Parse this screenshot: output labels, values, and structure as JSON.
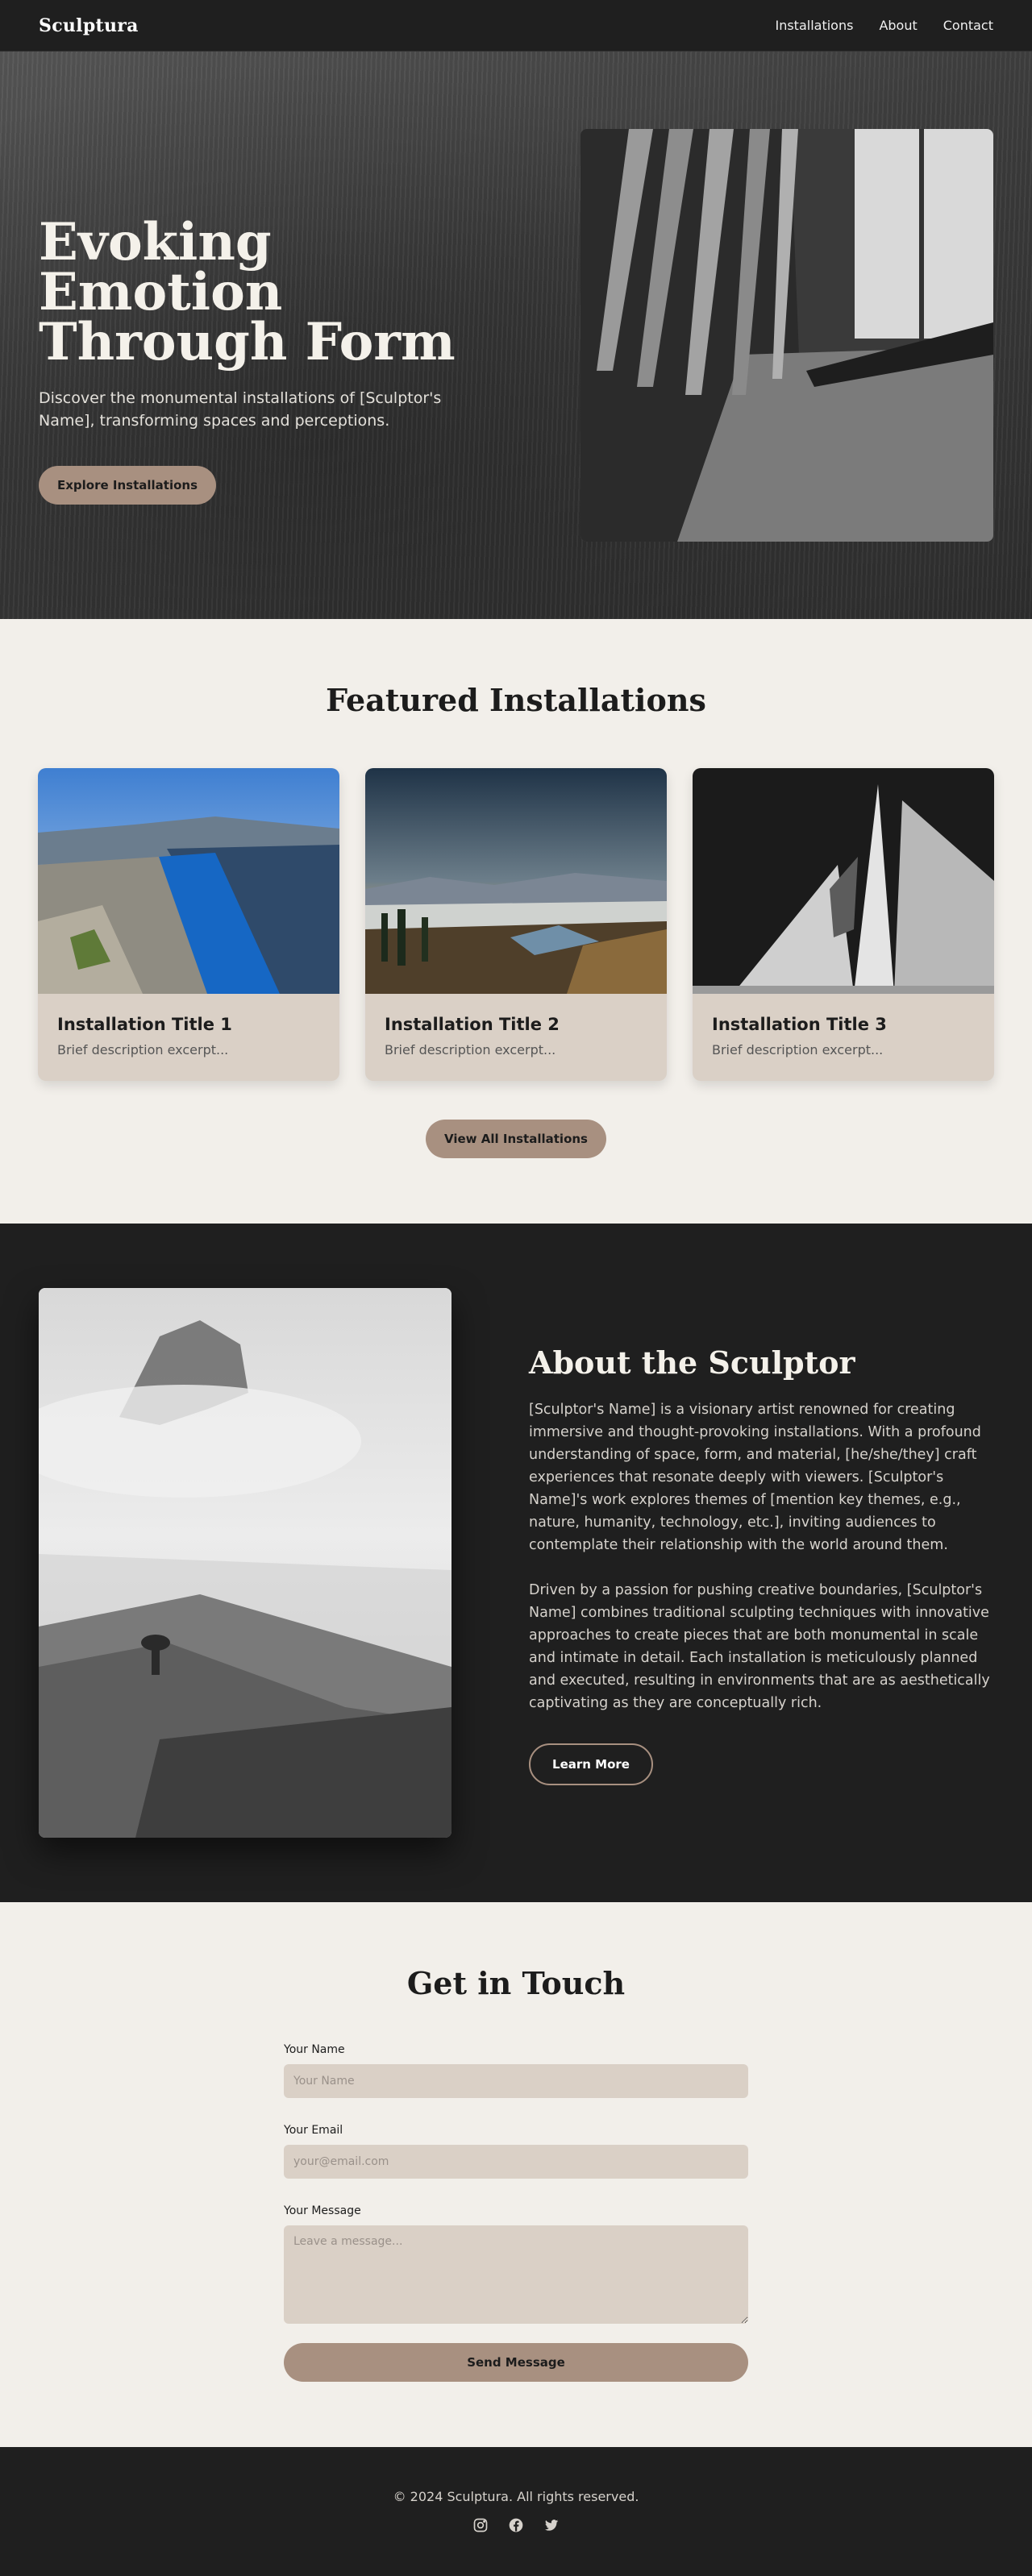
{
  "header": {
    "logo": "Sculptura",
    "nav": [
      "Installations",
      "About",
      "Contact"
    ]
  },
  "hero": {
    "title_line1": "Evoking Emotion",
    "title_line2": "Through Form",
    "subtitle": "Discover the monumental installations of [Sculptor's Name], transforming spaces and perceptions.",
    "cta": "Explore Installations"
  },
  "featured": {
    "title": "Featured Installations",
    "cards": [
      {
        "title": "Installation Title 1",
        "desc": "Brief description excerpt..."
      },
      {
        "title": "Installation Title 2",
        "desc": "Brief description excerpt..."
      },
      {
        "title": "Installation Title 3",
        "desc": "Brief description excerpt..."
      }
    ],
    "cta": "View All Installations"
  },
  "about": {
    "title": "About the Sculptor",
    "p1": "[Sculptor's Name] is a visionary artist renowned for creating immersive and thought-provoking installations. With a profound understanding of space, form, and material, [he/she/they] craft experiences that resonate deeply with viewers. [Sculptor's Name]'s work explores themes of [mention key themes, e.g., nature, humanity, technology, etc.], inviting audiences to contemplate their relationship with the world around them.",
    "p2": "Driven by a passion for pushing creative boundaries, [Sculptor's Name] combines traditional sculpting techniques with innovative approaches to create pieces that are both monumental in scale and intimate in detail. Each installation is meticulously planned and executed, resulting in environments that are as aesthetically captivating as they are conceptually rich.",
    "cta": "Learn More"
  },
  "contact": {
    "title": "Get in Touch",
    "name_label": "Your Name",
    "name_placeholder": "Your Name",
    "email_label": "Your Email",
    "email_placeholder": "your@email.com",
    "message_label": "Your Message",
    "message_placeholder": "Leave a message...",
    "submit": "Send Message"
  },
  "footer": {
    "copyright": "© 2024 Sculptura. All rights reserved.",
    "socials": [
      "instagram-icon",
      "facebook-icon",
      "twitter-icon"
    ]
  },
  "colors": {
    "accent": "#a89080",
    "dark": "#1f1f1f",
    "light_bg": "#f2efea",
    "card_bg": "#dad0c6"
  }
}
